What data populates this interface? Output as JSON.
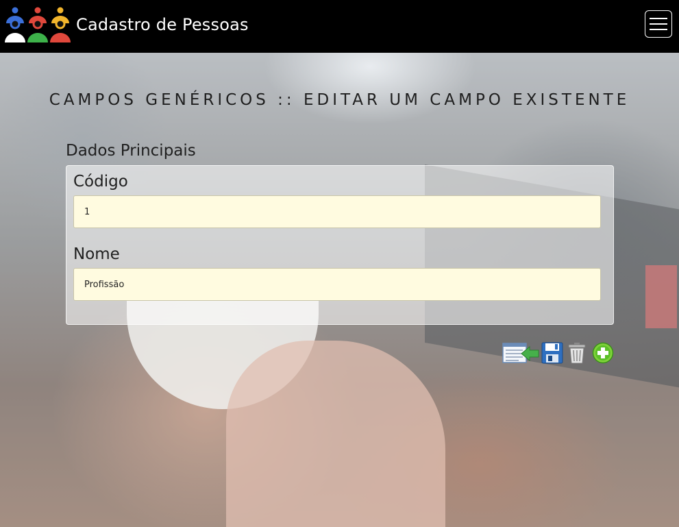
{
  "navbar": {
    "brand": "Cadastro de Pessoas",
    "logo_icon": "people-group-icon",
    "menu_icon": "hamburger-menu-icon"
  },
  "page": {
    "title": "CAMPOS GENÉRICOS :: EDITAR UM CAMPO EXISTENTE",
    "section_title": "Dados Principais"
  },
  "form": {
    "codigo": {
      "label": "Código",
      "value": "1"
    },
    "nome": {
      "label": "Nome",
      "value": "Profissão"
    }
  },
  "actions": [
    {
      "name": "back-to-list",
      "icon": "list-back-arrow-icon"
    },
    {
      "name": "save",
      "icon": "floppy-disk-icon"
    },
    {
      "name": "delete",
      "icon": "trash-can-icon"
    },
    {
      "name": "add-new",
      "icon": "plus-circle-icon"
    }
  ],
  "colors": {
    "navbar_bg": "#000000",
    "input_bg": "#fffbe0",
    "logo_blue": "#3b6fd8",
    "logo_red": "#e0483c",
    "logo_green": "#3db24a",
    "logo_yellow": "#f2b52c"
  }
}
